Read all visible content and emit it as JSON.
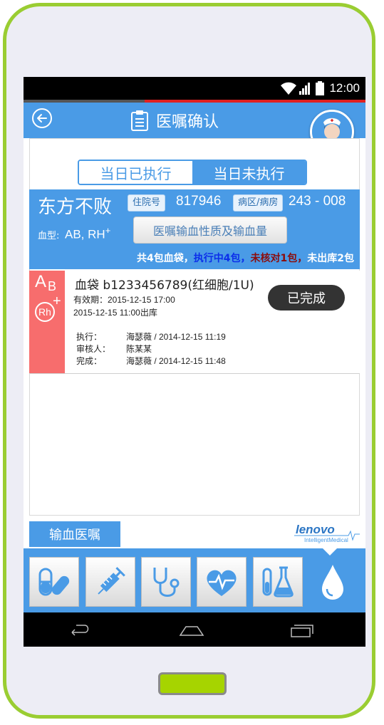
{
  "status_bar": {
    "time": "12:00"
  },
  "header": {
    "title": "医嘱确认"
  },
  "tabs": [
    {
      "label": "当日已执行",
      "active": false
    },
    {
      "label": "当日未执行",
      "active": true
    }
  ],
  "patient": {
    "name": "东方不败",
    "admission_label": "住院号",
    "admission_no": "817946",
    "ward_label": "病区/病房",
    "ward_no": "243 - 008",
    "blood_type_label": "血型:",
    "blood_type_value": "AB, RH",
    "rh_sign": "+",
    "detail_button": "医嘱输血性质及输血量",
    "summary": {
      "total": "共4包血袋，",
      "executing": "执行中4包，",
      "unchecked": "未核对1包，",
      "not_out": "未出库2包"
    }
  },
  "blood_bags": [
    {
      "badge_abo_a": "A",
      "badge_abo_b": "B",
      "badge_rh": "Rh",
      "badge_rh_sign": "+",
      "title": "血袋 b1233456789(红细胞/1U)",
      "expiry": "有效期：2015-12-15 17:00",
      "out_time": "2015-12-15 11:00出库",
      "execute_label": "执行：",
      "execute_value": "海瑟薇 / 2014-12-15 11:19",
      "reviewer_label": "审核人：",
      "reviewer_value": "陈某某",
      "complete_label": "完成：",
      "complete_value": "海瑟薇 / 2014-12-15 11:48",
      "status": "已完成"
    }
  ],
  "footer": {
    "order_button": "输血医嘱",
    "logo_text": "lenovo",
    "logo_sub": "IntelligentMedical"
  },
  "tab_bar": {
    "items": [
      "capsule-icon",
      "syringe-icon",
      "stethoscope-icon",
      "heart-pulse-icon",
      "lab-flask-icon",
      "blood-drop-icon"
    ]
  },
  "colors": {
    "primary": "#4a9be6",
    "blood_strip": "#f76d6d",
    "frame": "#9acd32",
    "home_button": "#a6d400"
  }
}
